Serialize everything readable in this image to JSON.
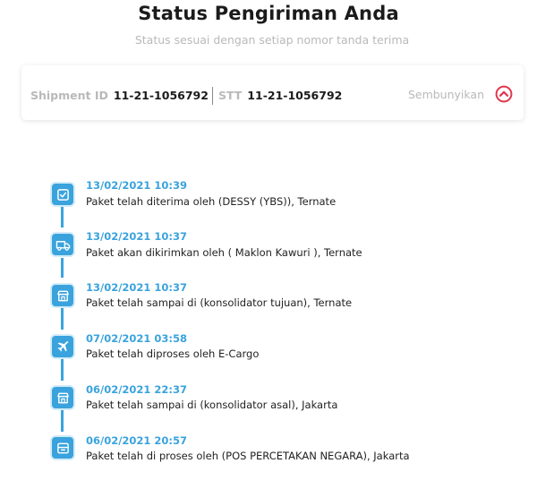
{
  "header": {
    "title": "Status Pengiriman Anda",
    "subtitle": "Status sesuai dengan setiap nomor tanda terima"
  },
  "shipment": {
    "shipment_label": "Shipment ID",
    "shipment_id": "11-21-1056792",
    "stt_label": "STT",
    "stt_value": "11-21-1056792",
    "toggle_label": "Sembunyikan",
    "toggle_icon": "chevron-up-circle-icon",
    "accent_color": "#e0384f"
  },
  "timeline": {
    "accent_color": "#3aa3dd",
    "events": [
      {
        "time": "13/02/2021 10:39",
        "description": "Paket telah diterima oleh (DESSY (YBS)), Ternate",
        "icon": "checkbox-icon"
      },
      {
        "time": "13/02/2021 10:37",
        "description": "Paket akan dikirimkan oleh ( Maklon Kawuri ), Ternate",
        "icon": "delivery-truck-icon"
      },
      {
        "time": "13/02/2021 10:37",
        "description": "Paket telah sampai di (konsolidator tujuan), Ternate",
        "icon": "store-icon"
      },
      {
        "time": "07/02/2021 03:58",
        "description": "Paket telah diproses oleh E-Cargo",
        "icon": "airplane-icon"
      },
      {
        "time": "06/02/2021 22:37",
        "description": "Paket telah sampai di (konsolidator asal), Jakarta",
        "icon": "store-icon"
      },
      {
        "time": "06/02/2021 20:57",
        "description": "Paket telah di proses oleh (POS PERCETAKAN NEGARA), Jakarta",
        "icon": "package-box-icon"
      }
    ]
  }
}
